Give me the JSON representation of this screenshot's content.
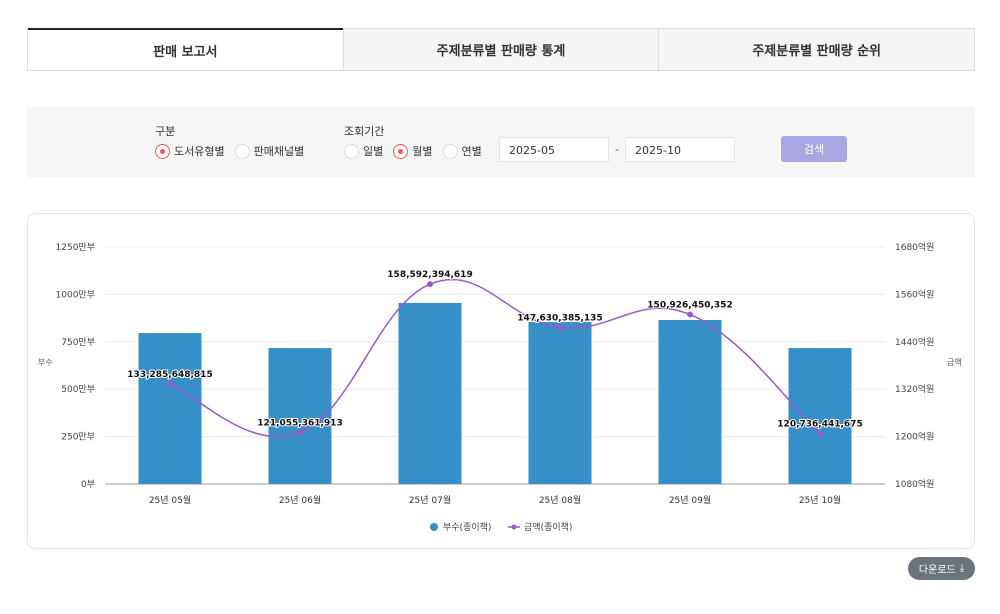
{
  "tabs": [
    "판매 보고서",
    "주제분류별 판매량 통계",
    "주제분류별 판매량 순위"
  ],
  "filter": {
    "type_label": "구분",
    "type_options": [
      "도서유형별",
      "판매채널별"
    ],
    "period_label": "조회기간",
    "period_options": [
      "일별",
      "월별",
      "연별"
    ],
    "start": "2025-05",
    "separator": "-",
    "end": "2025-10",
    "search_label": "검색"
  },
  "download_label": "다운로드",
  "colors": {
    "bar": "#368fc7",
    "line": "#9b59c9"
  },
  "chart_data": {
    "type": "bar",
    "categories": [
      "25년 05월",
      "25년 06월",
      "25년 07월",
      "25년 08월",
      "25년 09월",
      "25년 10월"
    ],
    "series": [
      {
        "name": "부수(종이책)",
        "type": "bar",
        "axis": "left",
        "unit": "만부",
        "values": [
          796,
          717,
          955,
          854,
          865,
          717
        ]
      },
      {
        "name": "금액(종이책)",
        "type": "line",
        "axis": "right",
        "unit": "원",
        "values": [
          133285648815,
          121055361913,
          158592394619,
          147630385135,
          150926450352,
          120736441675
        ],
        "labels": [
          "133,285,648,815",
          "121,055,361,913",
          "158,592,394,619",
          "147,630,385,135",
          "150,926,450,352",
          "120,736,441,675"
        ]
      }
    ],
    "ylabel": "부수",
    "y2label": "금액",
    "ylim": [
      0,
      1250
    ],
    "yticks": [
      "0부",
      "250만부",
      "500만부",
      "750만부",
      "1000만부",
      "1250만부"
    ],
    "y2lim": [
      1080,
      1680
    ],
    "y2ticks": [
      "1080억원",
      "1200억원",
      "1320억원",
      "1440억원",
      "1560억원",
      "1680억원"
    ],
    "legend": "bottom-center",
    "grid": true
  }
}
